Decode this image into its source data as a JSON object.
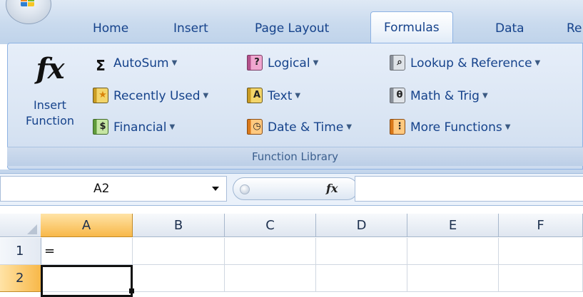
{
  "ribbon_tabs": [
    "Home",
    "Insert",
    "Page Layout",
    "Formulas",
    "Data",
    "Re"
  ],
  "active_tab": "Formulas",
  "insert_function": {
    "icon": "fx",
    "label_line1": "Insert",
    "label_line2": "Function"
  },
  "function_library": {
    "group_label": "Function Library",
    "commands": [
      {
        "label": "AutoSum",
        "icon": "sigma-icon",
        "has_dropdown": true
      },
      {
        "label": "Recently Used",
        "icon": "recently-used-book-icon",
        "has_dropdown": true
      },
      {
        "label": "Financial",
        "icon": "financial-book-icon",
        "has_dropdown": true
      },
      {
        "label": "Logical",
        "icon": "logical-book-icon",
        "has_dropdown": true
      },
      {
        "label": "Text",
        "icon": "text-book-icon",
        "has_dropdown": true
      },
      {
        "label": "Date & Time",
        "icon": "date-time-book-icon",
        "has_dropdown": true
      },
      {
        "label": "Lookup & Reference",
        "icon": "lookup-book-icon",
        "has_dropdown": true
      },
      {
        "label": "Math & Trig",
        "icon": "math-trig-book-icon",
        "has_dropdown": true
      },
      {
        "label": "More Functions",
        "icon": "more-functions-books-icon",
        "has_dropdown": true
      }
    ]
  },
  "formula_bar": {
    "name_box": "A2",
    "fx_label": "fx",
    "formula": ""
  },
  "sheet": {
    "columns": [
      "A",
      "B",
      "C",
      "D",
      "E",
      "F"
    ],
    "rows": [
      "1",
      "2"
    ],
    "cells": {
      "A1": "="
    },
    "selected_cell": "A2",
    "selected_column": "A",
    "selected_row": "2"
  }
}
